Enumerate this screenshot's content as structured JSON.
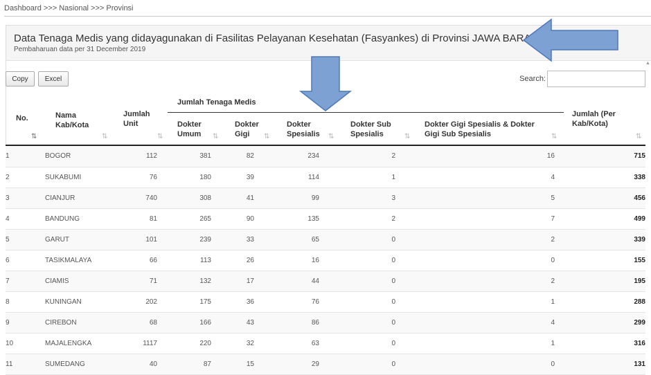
{
  "breadcrumb": "Dashboard >>> Nasional >>> Provinsi",
  "header": {
    "title": "Data Tenaga Medis yang didayagunakan di Fasilitas Pelayanan Kesehatan (Fasyankes) di Provinsi JAWA BARAT",
    "subtitle": "Pembaharuan data per 31 December 2019"
  },
  "toolbar": {
    "copy_label": "Copy",
    "excel_label": "Excel",
    "search_label": "Search:",
    "search_value": ""
  },
  "table": {
    "columns": {
      "no": "No.",
      "name": "Nama Kab/Kota",
      "unit": "Jumlah Unit",
      "group": "Jumlah Tenaga Medis",
      "dokter_umum": "Dokter Umum",
      "dokter_gigi": "Dokter Gigi",
      "dokter_spesialis": "Dokter Spesialis",
      "dokter_sub_spesialis": "Dokter Sub Spesialis",
      "gigi_spesialis": "Dokter Gigi Spesialis & Dokter Gigi Sub Spesialis",
      "total": "Jumlah (Per Kab/Kota)"
    },
    "rows": [
      [
        "1",
        "BOGOR",
        "112",
        "381",
        "82",
        "234",
        "2",
        "16",
        "715"
      ],
      [
        "2",
        "SUKABUMI",
        "76",
        "180",
        "39",
        "114",
        "1",
        "4",
        "338"
      ],
      [
        "3",
        "CIANJUR",
        "740",
        "308",
        "41",
        "99",
        "3",
        "5",
        "456"
      ],
      [
        "4",
        "BANDUNG",
        "81",
        "265",
        "90",
        "135",
        "2",
        "7",
        "499"
      ],
      [
        "5",
        "GARUT",
        "101",
        "239",
        "33",
        "65",
        "0",
        "2",
        "339"
      ],
      [
        "6",
        "TASIKMALAYA",
        "66",
        "113",
        "26",
        "16",
        "0",
        "0",
        "155"
      ],
      [
        "7",
        "CIAMIS",
        "71",
        "132",
        "17",
        "44",
        "0",
        "2",
        "195"
      ],
      [
        "8",
        "KUNINGAN",
        "202",
        "175",
        "36",
        "76",
        "0",
        "1",
        "288"
      ],
      [
        "9",
        "CIREBON",
        "68",
        "166",
        "43",
        "86",
        "0",
        "4",
        "299"
      ],
      [
        "10",
        "MAJALENGKA",
        "1117",
        "220",
        "32",
        "63",
        "0",
        "1",
        "316"
      ],
      [
        "11",
        "SUMEDANG",
        "40",
        "87",
        "15",
        "29",
        "0",
        "0",
        "131"
      ]
    ]
  },
  "icons": {
    "sort": "sort-icon",
    "arrow_color": "#7ea1d4"
  }
}
